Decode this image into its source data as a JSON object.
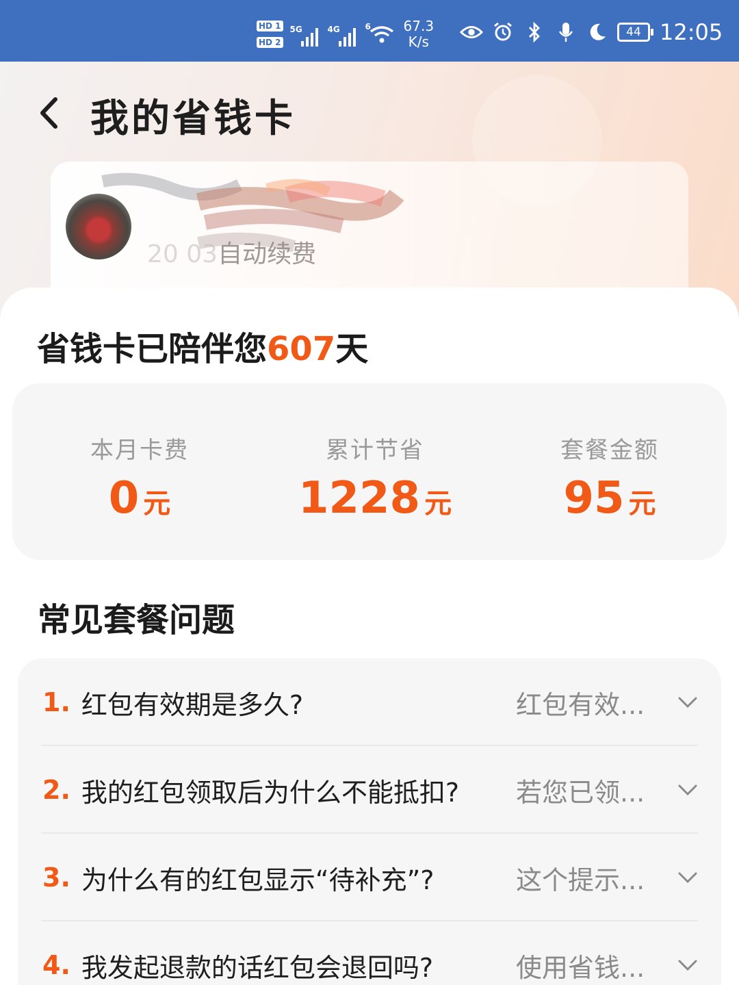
{
  "status_bar": {
    "hd1": "HD 1",
    "hd2": "HD 2",
    "sig1_gen": "5G",
    "sig2_gen": "4G",
    "wifi_gen": "6",
    "net_speed_value": "67.3",
    "net_speed_unit": "K/s",
    "battery": "44",
    "time": "12:05",
    "icons": [
      "eye-icon",
      "alarm-icon",
      "bluetooth-icon",
      "mic-icon",
      "moon-icon"
    ]
  },
  "header": {
    "title": "我的省钱卡",
    "back_icon": "back-icon"
  },
  "user_card": {
    "renew_visible": "20",
    "renew_blurred": "  03",
    "renew_label": "自动续费"
  },
  "companion": {
    "prefix": "省钱卡已陪伴您",
    "days": "607",
    "suffix": "天"
  },
  "stats": [
    {
      "label": "本月卡费",
      "value": "0",
      "unit": "元"
    },
    {
      "label": "累计节省",
      "value": "1228",
      "unit": "元"
    },
    {
      "label": "套餐金额",
      "value": "95",
      "unit": "元"
    }
  ],
  "faq": {
    "title": "常见套餐问题",
    "items": [
      {
        "index": "1.",
        "question": "红包有效期是多久?",
        "answer": "红包有效..."
      },
      {
        "index": "2.",
        "question": "我的红包领取后为什么不能抵扣?",
        "answer": "若您已领..."
      },
      {
        "index": "3.",
        "question": "为什么有的红包显示“待补充”?",
        "answer": "这个提示..."
      },
      {
        "index": "4.",
        "question": "我发起退款的话红包会退回吗?",
        "answer": "使用省钱..."
      }
    ]
  },
  "colors": {
    "status_bar": "#3f6fbf",
    "accent": "#f15a16",
    "text_primary": "#1e1e1e",
    "text_secondary": "#9a9a9a"
  }
}
